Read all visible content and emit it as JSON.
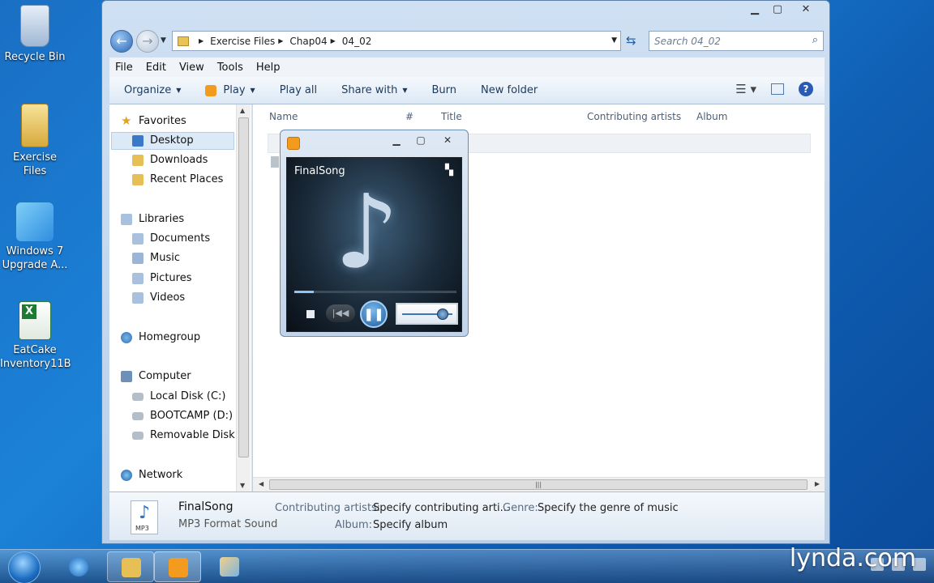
{
  "desktop": {
    "icons": [
      {
        "label": "Recycle Bin"
      },
      {
        "label": "Exercise Files"
      },
      {
        "label": "Windows 7 Upgrade A..."
      },
      {
        "label": "EatCake Inventory11B"
      }
    ]
  },
  "explorer": {
    "caption": {
      "minimize": "▁",
      "maximize": "▢",
      "close": "✕"
    },
    "breadcrumb": [
      "Exercise Files",
      "Chap04",
      "04_02"
    ],
    "search": {
      "placeholder": "Search 04_02"
    },
    "menu": [
      "File",
      "Edit",
      "View",
      "Tools",
      "Help"
    ],
    "toolbar": {
      "organize": "Organize",
      "play": "Play",
      "play_all": "Play all",
      "share_with": "Share with",
      "burn": "Burn",
      "new_folder": "New folder"
    },
    "nav": {
      "favorites": "Favorites",
      "desktop": "Desktop",
      "downloads": "Downloads",
      "recent_places": "Recent Places",
      "libraries": "Libraries",
      "documents": "Documents",
      "music": "Music",
      "pictures": "Pictures",
      "videos": "Videos",
      "homegroup": "Homegroup",
      "computer": "Computer",
      "local_disk": "Local Disk (C:)",
      "bootcamp": "BOOTCAMP (D:)",
      "removable": "Removable Disk (",
      "network": "Network"
    },
    "columns": {
      "name": "Name",
      "number": "#",
      "title": "Title",
      "artists": "Contributing artists",
      "album": "Album"
    },
    "details": {
      "file_name": "FinalSong",
      "file_type": "MP3 Format Sound",
      "icon_label": "MP3",
      "artists_label": "Contributing artists:",
      "artists_value": "Specify contributing arti...",
      "genre_label": "Genre:",
      "genre_value": "Specify the genre of music",
      "album_label": "Album:",
      "album_value": "Specify album"
    }
  },
  "player": {
    "song_title": "FinalSong",
    "seek_progress": 0.12,
    "volume_level": 0.8
  },
  "watermark": "lynda.com"
}
